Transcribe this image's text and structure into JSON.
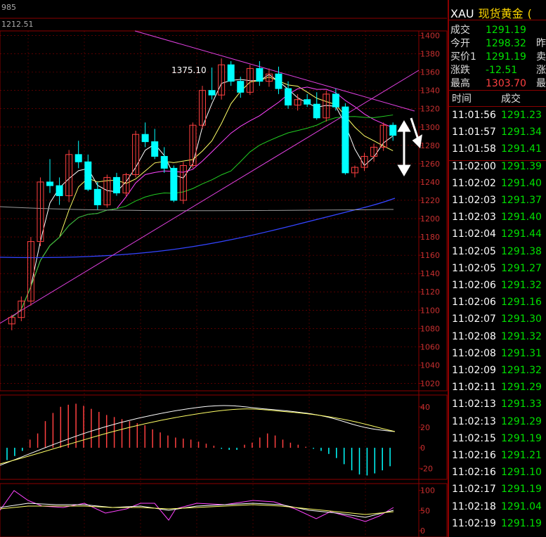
{
  "top_left": {
    "code": "985",
    "ma_value": "1212.51"
  },
  "header": {
    "symbol": "XAU",
    "name": "现货黄金",
    "flag": "("
  },
  "quotes": [
    {
      "k": "成交",
      "v": "1291.19",
      "color": "#00e000",
      "x": ""
    },
    {
      "k": "今开",
      "v": "1298.32",
      "color": "#00e000",
      "x": "昨"
    },
    {
      "k": "买价1",
      "v": "1291.19",
      "color": "#00e000",
      "x": "卖"
    },
    {
      "k": "涨跌",
      "v": "-12.51",
      "color": "#00e000",
      "x": "涨"
    },
    {
      "k": "最高",
      "v": "1303.70",
      "color": "#ff4040",
      "x": "最"
    }
  ],
  "table_header": {
    "time": "时间",
    "price": "成交"
  },
  "ticks": [
    {
      "t": "11:01:56",
      "p": "1291.23",
      "c": "dn"
    },
    {
      "t": "11:01:57",
      "p": "1291.34",
      "c": "dn"
    },
    {
      "t": "11:01:58",
      "p": "1291.41",
      "c": "dn"
    },
    {
      "t": "11:02:00",
      "p": "1291.39",
      "c": "dn"
    },
    {
      "t": "11:02:02",
      "p": "1291.40",
      "c": "dn"
    },
    {
      "t": "11:02:03",
      "p": "1291.37",
      "c": "dn"
    },
    {
      "t": "11:02:03",
      "p": "1291.40",
      "c": "dn"
    },
    {
      "t": "11:02:04",
      "p": "1291.44",
      "c": "dn"
    },
    {
      "t": "11:02:05",
      "p": "1291.38",
      "c": "dn"
    },
    {
      "t": "11:02:05",
      "p": "1291.27",
      "c": "dn"
    },
    {
      "t": "11:02:06",
      "p": "1291.32",
      "c": "dn"
    },
    {
      "t": "11:02:06",
      "p": "1291.16",
      "c": "dn"
    },
    {
      "t": "11:02:07",
      "p": "1291.30",
      "c": "dn"
    },
    {
      "t": "11:02:08",
      "p": "1291.32",
      "c": "dn"
    },
    {
      "t": "11:02:08",
      "p": "1291.31",
      "c": "dn"
    },
    {
      "t": "11:02:09",
      "p": "1291.32",
      "c": "dn"
    },
    {
      "t": "11:02:11",
      "p": "1291.29",
      "c": "dn"
    },
    {
      "t": "11:02:13",
      "p": "1291.33",
      "c": "dn"
    },
    {
      "t": "11:02:13",
      "p": "1291.29",
      "c": "dn"
    },
    {
      "t": "11:02:15",
      "p": "1291.19",
      "c": "dn"
    },
    {
      "t": "11:02:16",
      "p": "1291.21",
      "c": "dn"
    },
    {
      "t": "11:02:16",
      "p": "1291.10",
      "c": "dn"
    },
    {
      "t": "11:02:17",
      "p": "1291.19",
      "c": "dn"
    },
    {
      "t": "11:02:18",
      "p": "1291.04",
      "c": "dn"
    },
    {
      "t": "11:02:19",
      "p": "1291.19",
      "c": "dn"
    }
  ],
  "chart_data": {
    "type": "candlestick",
    "price_axis": {
      "ticks": [
        1400,
        1380,
        1360,
        1340,
        1320,
        1300,
        1280,
        1260,
        1240,
        1220,
        1200,
        1180,
        1160,
        1140,
        1120,
        1100,
        1080,
        1060,
        1040,
        1020
      ],
      "range": [
        1015,
        1405
      ]
    },
    "annotation": "1375.10",
    "candles": [
      [
        1085,
        1095,
        1078,
        1092
      ],
      [
        1092,
        1115,
        1088,
        1110
      ],
      [
        1110,
        1180,
        1105,
        1175
      ],
      [
        1175,
        1245,
        1170,
        1240
      ],
      [
        1240,
        1265,
        1228,
        1236
      ],
      [
        1236,
        1245,
        1215,
        1225
      ],
      [
        1225,
        1275,
        1218,
        1270
      ],
      [
        1270,
        1285,
        1255,
        1262
      ],
      [
        1262,
        1270,
        1230,
        1232
      ],
      [
        1232,
        1240,
        1210,
        1215
      ],
      [
        1215,
        1248,
        1212,
        1245
      ],
      [
        1245,
        1250,
        1225,
        1228
      ],
      [
        1228,
        1250,
        1224,
        1248
      ],
      [
        1248,
        1296,
        1245,
        1292
      ],
      [
        1292,
        1305,
        1278,
        1284
      ],
      [
        1284,
        1298,
        1265,
        1268
      ],
      [
        1268,
        1278,
        1250,
        1255
      ],
      [
        1255,
        1258,
        1218,
        1220
      ],
      [
        1220,
        1262,
        1216,
        1258
      ],
      [
        1258,
        1305,
        1255,
        1302
      ],
      [
        1302,
        1345,
        1298,
        1340
      ],
      [
        1340,
        1365,
        1330,
        1335
      ],
      [
        1335,
        1375,
        1330,
        1368
      ],
      [
        1368,
        1372,
        1345,
        1350
      ],
      [
        1350,
        1355,
        1332,
        1338
      ],
      [
        1338,
        1368,
        1335,
        1364
      ],
      [
        1364,
        1372,
        1345,
        1350
      ],
      [
        1350,
        1364,
        1344,
        1358
      ],
      [
        1358,
        1366,
        1336,
        1342
      ],
      [
        1342,
        1350,
        1320,
        1324
      ],
      [
        1324,
        1336,
        1318,
        1330
      ],
      [
        1330,
        1336,
        1322,
        1325
      ],
      [
        1325,
        1338,
        1308,
        1310
      ],
      [
        1310,
        1340,
        1306,
        1336
      ],
      [
        1336,
        1342,
        1318,
        1322
      ],
      [
        1322,
        1326,
        1248,
        1250
      ],
      [
        1250,
        1258,
        1245,
        1256
      ],
      [
        1256,
        1272,
        1252,
        1268
      ],
      [
        1268,
        1282,
        1262,
        1278
      ],
      [
        1278,
        1305,
        1274,
        1302
      ],
      [
        1302,
        1305,
        1285,
        1291
      ]
    ],
    "macd_axis": {
      "ticks": [
        40,
        20,
        0,
        -20
      ],
      "range": [
        -26,
        46
      ]
    },
    "macd_hist": [
      -12,
      -8,
      -3,
      8,
      14,
      26,
      34,
      40,
      42,
      43,
      41,
      38,
      35,
      32,
      30,
      28,
      26,
      24,
      22,
      18,
      15,
      12,
      10,
      9,
      8,
      6,
      4,
      2,
      -1,
      -2,
      -2,
      3,
      5,
      10,
      14,
      12,
      8,
      5,
      3,
      1,
      -1,
      -3,
      -6,
      -10,
      -16,
      -22,
      -26,
      -27,
      -25,
      -22,
      -18
    ],
    "kdj_axis": {
      "ticks": [
        100,
        50,
        0
      ],
      "range": [
        -5,
        110
      ]
    }
  }
}
